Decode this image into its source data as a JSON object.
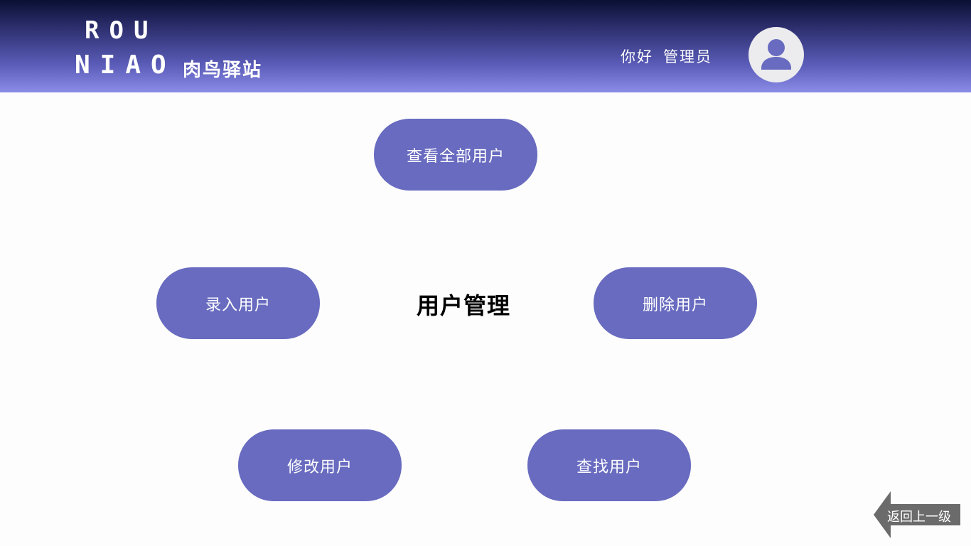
{
  "header": {
    "logo_line1": "ROU",
    "logo_line2": "NIAO",
    "logo_cn": "肉鸟驿站",
    "greeting_hello": "你好",
    "greeting_role": "管理员"
  },
  "main": {
    "title": "用户管理",
    "buttons": {
      "view_all": "查看全部用户",
      "add": "录入用户",
      "delete": "删除用户",
      "edit": "修改用户",
      "find": "查找用户"
    },
    "back_label": "返回上一级"
  },
  "colors": {
    "button": "#686bbf",
    "header_top": "#0a0f33",
    "header_bottom": "#8a8ce6",
    "back_arrow": "#6b6b6b"
  },
  "icons": {
    "avatar": "user-icon",
    "back": "arrow-left-icon"
  }
}
